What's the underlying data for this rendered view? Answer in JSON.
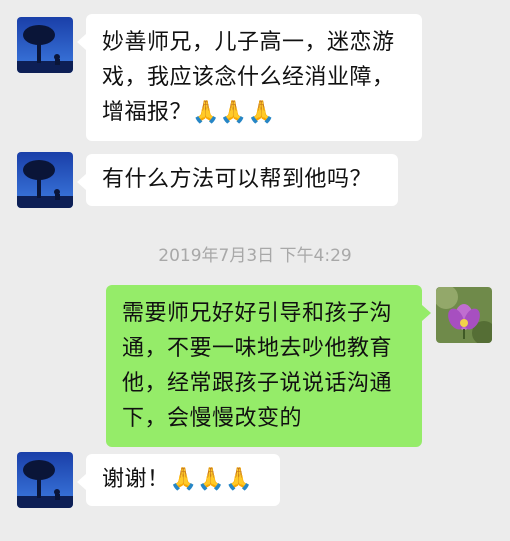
{
  "messages": [
    {
      "text": "妙善师兄，儿子高一，迷恋游戏，我应该念什么经消业障，增福报？🙏🙏🙏"
    },
    {
      "text": "有什么方法可以帮到他吗？"
    },
    {
      "text": "需要师兄好好引导和孩子沟通，不要一味地去吵他教育他，经常跟孩子说说话沟通下，会慢慢改变的"
    },
    {
      "text": "谢谢！🙏🙏🙏"
    }
  ],
  "timestamp": "2019年7月3日 下午4:29",
  "colors": {
    "background": "#ececec",
    "incoming_bubble": "#ffffff",
    "outgoing_bubble": "#95ec69",
    "timestamp": "#a8a8a8"
  }
}
